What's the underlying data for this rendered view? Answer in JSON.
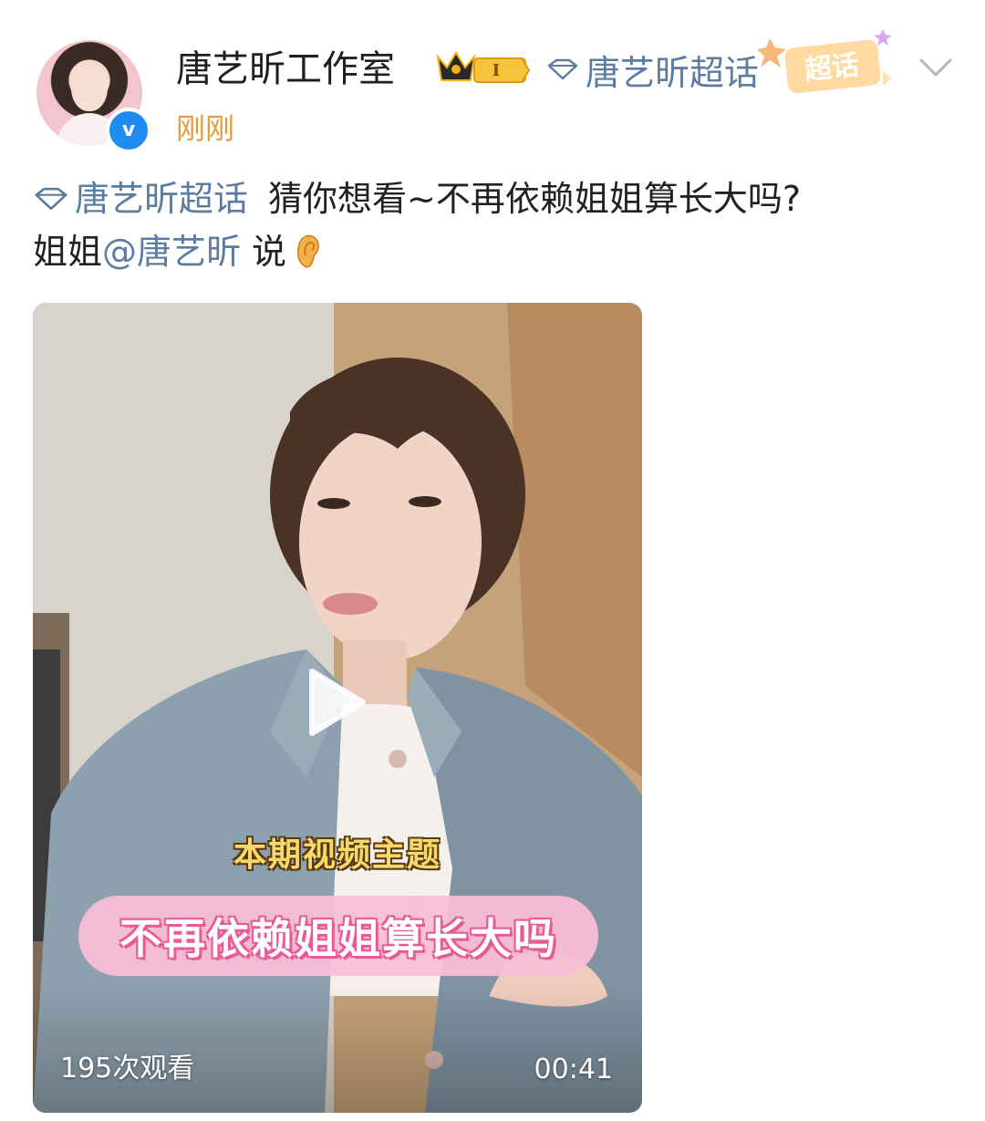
{
  "header": {
    "username": "唐艺昕工作室",
    "member_badge_text": "I",
    "topic_label": "唐艺昕超话",
    "chaohua_tag_text": "超话",
    "timestamp": "刚刚",
    "verify_mark": "v"
  },
  "post": {
    "topic_link": "唐艺昕超话",
    "line1_text": "猜你想看~不再依赖姐姐算长大吗?",
    "line2_prefix": "姐姐",
    "mention": "@唐艺昕",
    "line2_suffix": "说"
  },
  "video": {
    "caption_title": "本期视频主题",
    "caption_main": "不再依赖姐姐算长大吗",
    "view_count": "195次观看",
    "duration": "00:41"
  },
  "icons": {
    "topic": "diamond-icon",
    "play": "play-icon",
    "dropdown": "chevron-down-icon",
    "ear": "ear-emoji"
  },
  "colors": {
    "link": "#5c7ca0",
    "timestamp": "#e79a3d",
    "verify": "#1e8cf0",
    "caption_pink": "#e85a96",
    "caption_yellow": "#f7d86b"
  }
}
